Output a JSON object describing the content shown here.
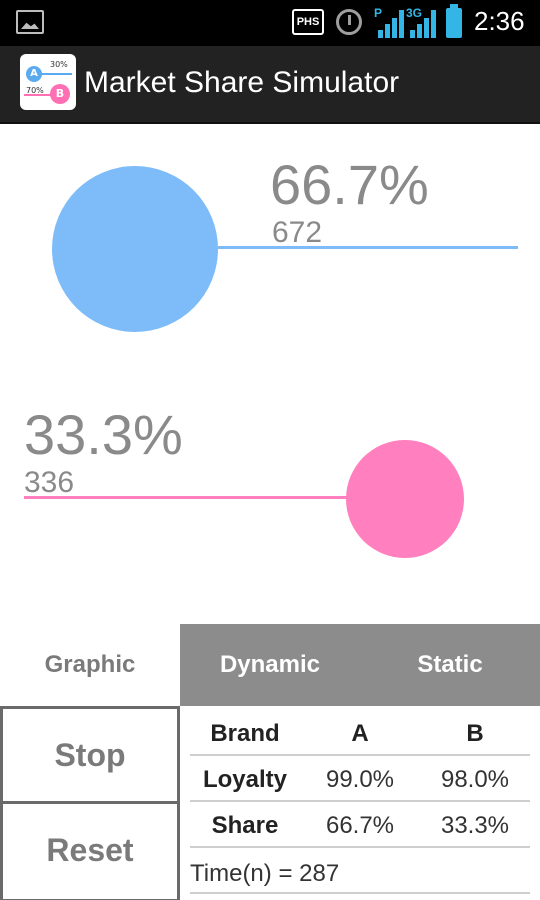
{
  "status_bar": {
    "phs_label": "PHS",
    "signal1_tag": "P",
    "signal2_tag": "3G",
    "time": "2:36",
    "accent": "#33b5e5"
  },
  "action_bar": {
    "title": "Market Share Simulator",
    "icon": {
      "a_label": "A",
      "b_label": "B",
      "a_pct": "30%",
      "b_pct": "70%"
    }
  },
  "graphic": {
    "brand_a": {
      "share_text": "66.7%",
      "count_text": "672",
      "share": 0.667,
      "color": "#7dbcf8"
    },
    "brand_b": {
      "share_text": "33.3%",
      "count_text": "336",
      "share": 0.333,
      "color": "#ff7fbf"
    }
  },
  "tabs": {
    "graphic": "Graphic",
    "dynamic": "Dynamic",
    "static": "Static",
    "active": "Graphic"
  },
  "controls": {
    "stop_label": "Stop",
    "reset_label": "Reset"
  },
  "table": {
    "headers": [
      "Brand",
      "A",
      "B"
    ],
    "rows": [
      [
        "Loyalty",
        "99.0%",
        "98.0%"
      ],
      [
        "Share",
        "66.7%",
        "33.3%"
      ]
    ],
    "time_text": "Time(n) = 287"
  }
}
